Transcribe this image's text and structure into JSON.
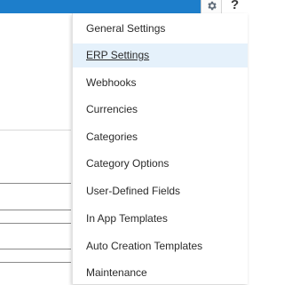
{
  "header": {
    "gear_icon": "gear-icon",
    "help_label": "?",
    "bar_color": "#1d7ecb"
  },
  "settings_menu": {
    "active_item": "ERP Settings",
    "active_bg": "#e5f1fb",
    "items": [
      {
        "label": "General Settings"
      },
      {
        "label": "ERP Settings"
      },
      {
        "label": "Webhooks"
      },
      {
        "label": "Currencies"
      },
      {
        "label": "Categories"
      },
      {
        "label": "Category Options"
      },
      {
        "label": "User-Defined Fields"
      },
      {
        "label": "In App Templates"
      },
      {
        "label": "Auto Creation Templates"
      },
      {
        "label": "Maintenance"
      }
    ]
  }
}
